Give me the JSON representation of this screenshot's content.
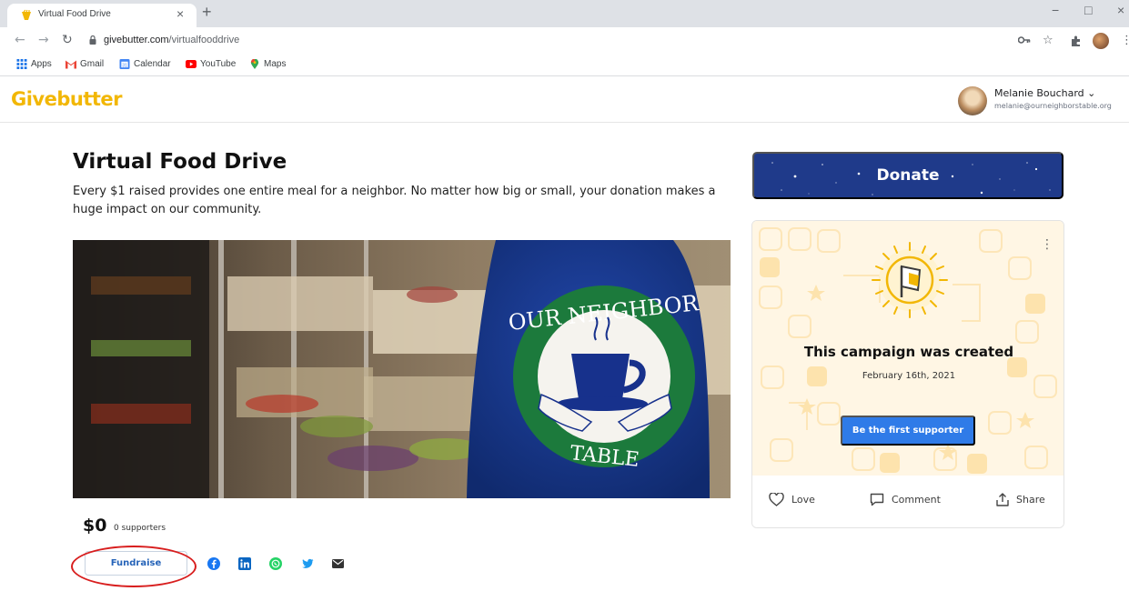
{
  "browser": {
    "tab_title": "Virtual Food Drive",
    "tab_close": "×",
    "new_tab": "+",
    "url_host": "givebutter.com",
    "url_path": "/virtualfooddrive",
    "window_controls": {
      "minimize": "−",
      "maximize": "□",
      "close": "×"
    },
    "bookmarks": [
      {
        "label": "Apps",
        "icon": "apps-grid-icon"
      },
      {
        "label": "Gmail",
        "icon": "gmail-icon"
      },
      {
        "label": "Calendar",
        "icon": "calendar-icon"
      },
      {
        "label": "YouTube",
        "icon": "youtube-icon"
      },
      {
        "label": "Maps",
        "icon": "maps-pin-icon"
      }
    ]
  },
  "header": {
    "logo": "Givebutter",
    "user_name": "Melanie Bouchard ⌄",
    "user_email": "melanie@ourneighborstable.org"
  },
  "campaign": {
    "title": "Virtual Food Drive",
    "description": "Every $1 raised provides one entire meal for a neighbor. No matter how big or small, your donation makes a huge impact on our community.",
    "raised": "$0",
    "supporters": "0 supporters",
    "fundraise_label": "Fundraise",
    "share_icons": [
      "facebook-icon",
      "linkedin-icon",
      "whatsapp-icon",
      "twitter-icon",
      "email-icon"
    ]
  },
  "sidebar": {
    "donate_label": "Donate",
    "card_menu": "⋮",
    "created_title": "This campaign was created",
    "created_date": "February 16th, 2021",
    "first_supporter_label": "Be the first supporter",
    "actions": {
      "love": "Love",
      "comment": "Comment",
      "share": "Share"
    }
  },
  "colors": {
    "brand_yellow": "#f2b705",
    "donate_navy": "#1f3a8a",
    "primary_blue": "#2f7be8",
    "annotation_red": "#d81e1e"
  }
}
